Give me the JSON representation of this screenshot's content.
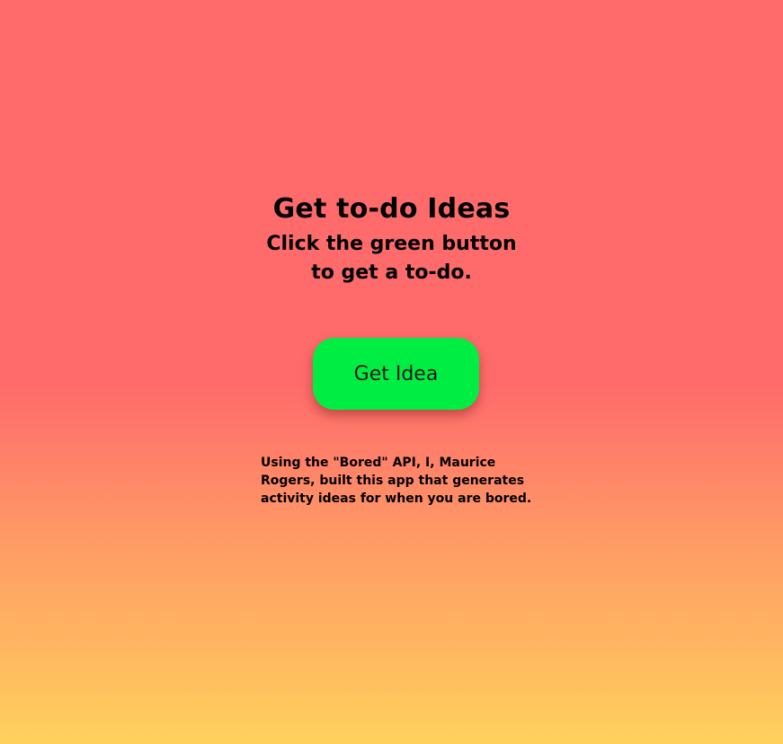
{
  "header": {
    "title": "Get to-do Ideas",
    "subtitle_lines": [
      "Click the green button",
      "to get a to-do."
    ]
  },
  "action": {
    "button_label": "Get Idea"
  },
  "footer": {
    "credit_lines": [
      "Using the \"Bored\" API, I, Maurice",
      "Rogers, built this app that generates",
      "activity ideas for when you are bored."
    ]
  },
  "colors": {
    "background_top": "#ff6b6b",
    "background_bottom": "#ffd15c",
    "button": "#00ee44",
    "text": "#000000"
  }
}
